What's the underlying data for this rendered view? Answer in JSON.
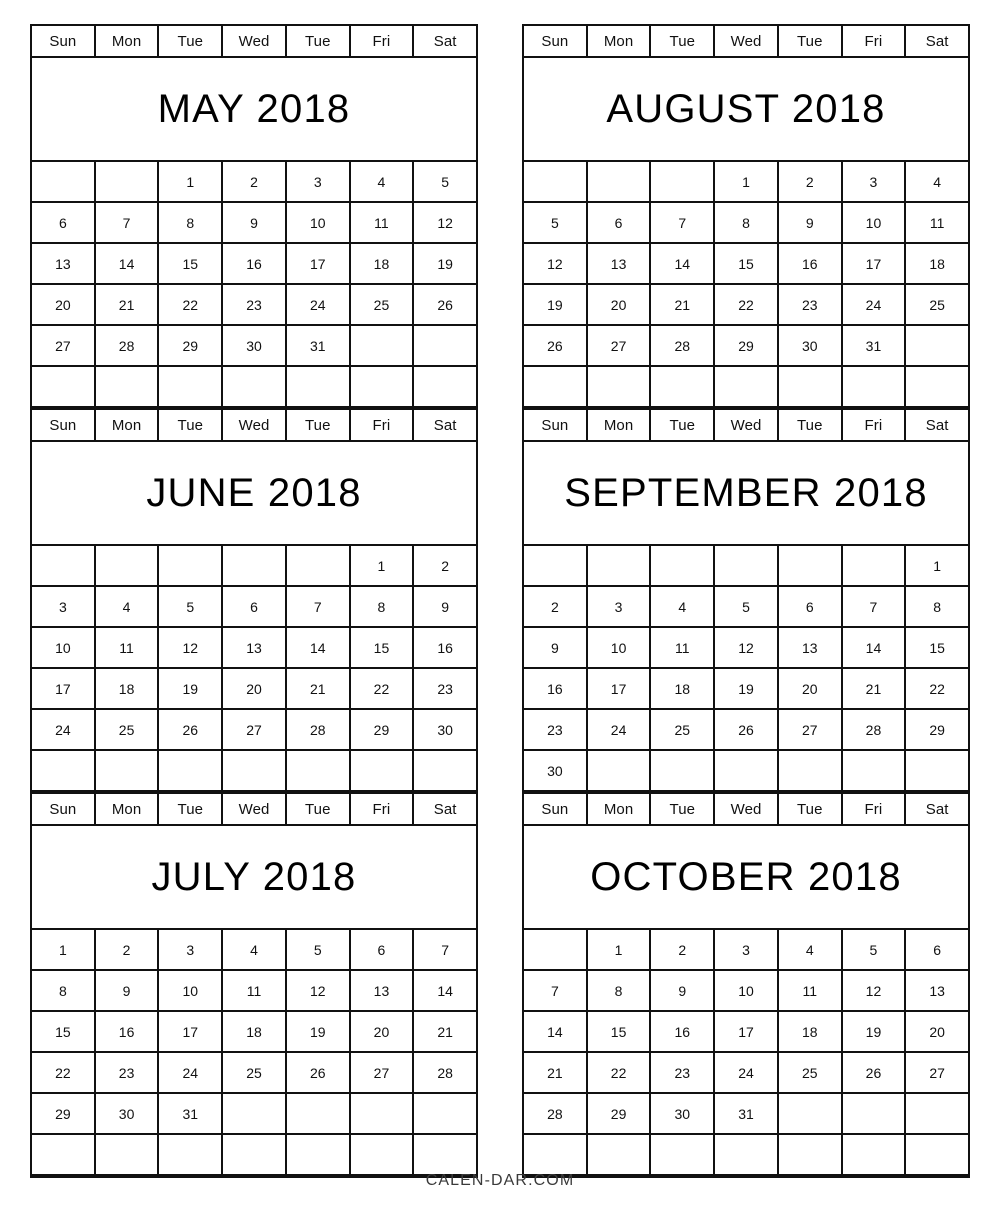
{
  "document": {
    "kind": "printable-calendar",
    "year": "2018",
    "footer": "CALEN-DAR.COM"
  },
  "weekdays": [
    "Sun",
    "Mon",
    "Tue",
    "Wed",
    "Tue",
    "Fri",
    "Sat"
  ],
  "colors": {
    "grid_line": "#111111",
    "text": "#111111",
    "title_text": "#000000",
    "background": "#ffffff",
    "footer_text": "#3a3a3a"
  },
  "columns": [
    {
      "months": [
        {
          "title": "MAY 2018",
          "name": "May",
          "year": "2018",
          "start_weekday_index": 2,
          "days_in_month": 31,
          "weeks": [
            [
              "",
              "",
              "1",
              "2",
              "3",
              "4",
              "5"
            ],
            [
              "6",
              "7",
              "8",
              "9",
              "10",
              "11",
              "12"
            ],
            [
              "13",
              "14",
              "15",
              "16",
              "17",
              "18",
              "19"
            ],
            [
              "20",
              "21",
              "22",
              "23",
              "24",
              "25",
              "26"
            ],
            [
              "27",
              "28",
              "29",
              "30",
              "31",
              "",
              ""
            ],
            [
              "",
              "",
              "",
              "",
              "",
              "",
              ""
            ]
          ]
        },
        {
          "title": "JUNE 2018",
          "name": "June",
          "year": "2018",
          "start_weekday_index": 5,
          "days_in_month": 30,
          "weeks": [
            [
              "",
              "",
              "",
              "",
              "",
              "1",
              "2"
            ],
            [
              "3",
              "4",
              "5",
              "6",
              "7",
              "8",
              "9"
            ],
            [
              "10",
              "11",
              "12",
              "13",
              "14",
              "15",
              "16"
            ],
            [
              "17",
              "18",
              "19",
              "20",
              "21",
              "22",
              "23"
            ],
            [
              "24",
              "25",
              "26",
              "27",
              "28",
              "29",
              "30"
            ],
            [
              "",
              "",
              "",
              "",
              "",
              "",
              ""
            ]
          ]
        },
        {
          "title": "JULY 2018",
          "name": "July",
          "year": "2018",
          "start_weekday_index": 0,
          "days_in_month": 31,
          "weeks": [
            [
              "1",
              "2",
              "3",
              "4",
              "5",
              "6",
              "7"
            ],
            [
              "8",
              "9",
              "10",
              "11",
              "12",
              "13",
              "14"
            ],
            [
              "15",
              "16",
              "17",
              "18",
              "19",
              "20",
              "21"
            ],
            [
              "22",
              "23",
              "24",
              "25",
              "26",
              "27",
              "28"
            ],
            [
              "29",
              "30",
              "31",
              "",
              "",
              "",
              ""
            ],
            [
              "",
              "",
              "",
              "",
              "",
              "",
              ""
            ]
          ]
        }
      ]
    },
    {
      "months": [
        {
          "title": "AUGUST 2018",
          "name": "August",
          "year": "2018",
          "start_weekday_index": 3,
          "days_in_month": 31,
          "weeks": [
            [
              "",
              "",
              "",
              "1",
              "2",
              "3",
              "4"
            ],
            [
              "5",
              "6",
              "7",
              "8",
              "9",
              "10",
              "11"
            ],
            [
              "12",
              "13",
              "14",
              "15",
              "16",
              "17",
              "18"
            ],
            [
              "19",
              "20",
              "21",
              "22",
              "23",
              "24",
              "25"
            ],
            [
              "26",
              "27",
              "28",
              "29",
              "30",
              "31",
              ""
            ],
            [
              "",
              "",
              "",
              "",
              "",
              "",
              ""
            ]
          ]
        },
        {
          "title": "SEPTEMBER 2018",
          "name": "September",
          "year": "2018",
          "start_weekday_index": 6,
          "days_in_month": 30,
          "weeks": [
            [
              "",
              "",
              "",
              "",
              "",
              "",
              "1"
            ],
            [
              "2",
              "3",
              "4",
              "5",
              "6",
              "7",
              "8"
            ],
            [
              "9",
              "10",
              "11",
              "12",
              "13",
              "14",
              "15"
            ],
            [
              "16",
              "17",
              "18",
              "19",
              "20",
              "21",
              "22"
            ],
            [
              "23",
              "24",
              "25",
              "26",
              "27",
              "28",
              "29"
            ],
            [
              "30",
              "",
              "",
              "",
              "",
              "",
              ""
            ]
          ]
        },
        {
          "title": "OCTOBER 2018",
          "name": "October",
          "year": "2018",
          "start_weekday_index": 1,
          "days_in_month": 31,
          "weeks": [
            [
              "",
              "1",
              "2",
              "3",
              "4",
              "5",
              "6"
            ],
            [
              "7",
              "8",
              "9",
              "10",
              "11",
              "12",
              "13"
            ],
            [
              "14",
              "15",
              "16",
              "17",
              "18",
              "19",
              "20"
            ],
            [
              "21",
              "22",
              "23",
              "24",
              "25",
              "26",
              "27"
            ],
            [
              "28",
              "29",
              "30",
              "31",
              "",
              "",
              ""
            ],
            [
              "",
              "",
              "",
              "",
              "",
              "",
              ""
            ]
          ]
        }
      ]
    }
  ]
}
